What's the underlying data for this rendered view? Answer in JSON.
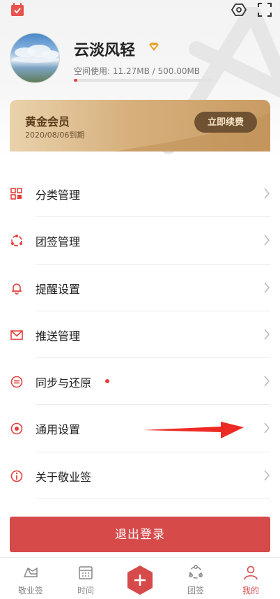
{
  "profile": {
    "username": "云淡风轻",
    "storage_label": "空间使用: 11.27MB / 500.00MB",
    "storage_used_fraction": 0.0225
  },
  "vip": {
    "title": "黄金会员",
    "expire": "2020/08/06到期",
    "renew_label": "立即续费"
  },
  "menu": {
    "items": [
      {
        "label": "分类管理",
        "icon": "category-icon"
      },
      {
        "label": "团签管理",
        "icon": "team-icon"
      },
      {
        "label": "提醒设置",
        "icon": "bell-icon"
      },
      {
        "label": "推送管理",
        "icon": "mail-icon"
      },
      {
        "label": "同步与还原",
        "icon": "sync-icon",
        "badge": true
      },
      {
        "label": "通用设置",
        "icon": "settings-icon"
      },
      {
        "label": "关于敬业签",
        "icon": "info-icon"
      }
    ]
  },
  "logout_label": "退出登录",
  "tabs": [
    {
      "label": "敬业签",
      "icon": "note-icon",
      "active": false
    },
    {
      "label": "时间",
      "icon": "calendar-icon",
      "active": false
    },
    {
      "label": "团签",
      "icon": "group-icon",
      "active": false
    },
    {
      "label": "我的",
      "icon": "user-icon",
      "active": true
    }
  ],
  "colors": {
    "accent": "#d64a4a",
    "badge": "#e3413c",
    "gold_dark": "#6f5232"
  }
}
